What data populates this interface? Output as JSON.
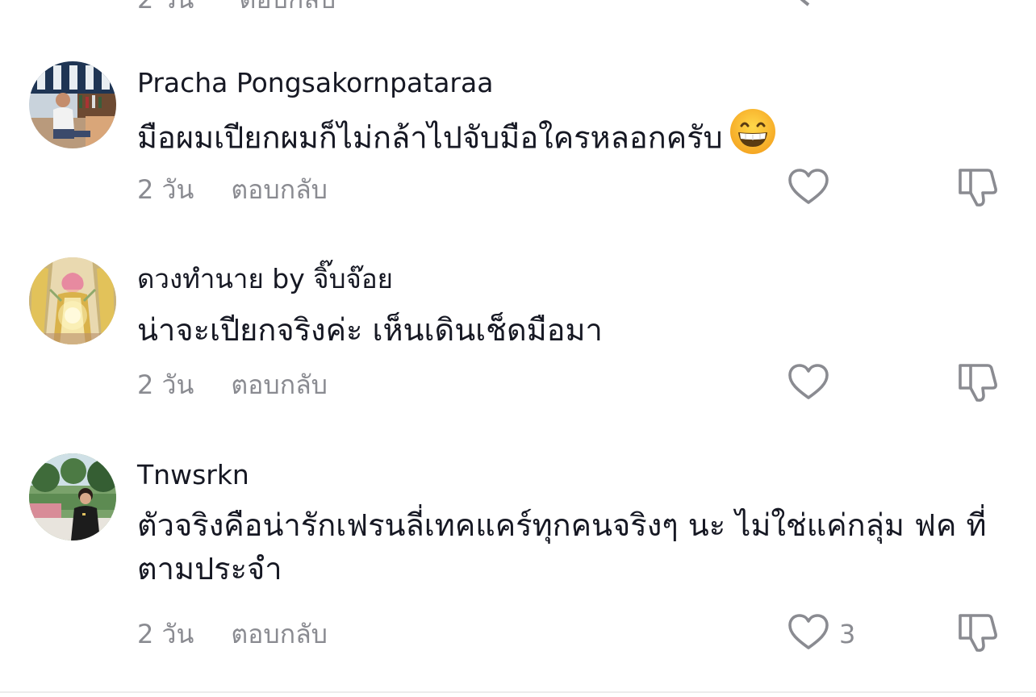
{
  "previous_comment": {
    "time": "2 วัน",
    "reply_label": "ตอบกลับ"
  },
  "comments": [
    {
      "username": "Pracha Pongsakornpataraa",
      "text": "มือผมเปียกผมก็ไม่กล้าไปจับมือใครหลอกครับ",
      "emoji": "grinning-face-emoji",
      "time": "2 วัน",
      "reply_label": "ตอบกลับ",
      "like_count": ""
    },
    {
      "username": "ดวงทำนาย by จิ๊บจ๊อย",
      "text": "น่าจะเปียกจริงค่ะ เห็นเดินเช็ดมือมา",
      "time": "2 วัน",
      "reply_label": "ตอบกลับ",
      "like_count": ""
    },
    {
      "username": "Tnwsrkn",
      "text": "ตัวจริงคือน่ารักเฟรนลี่เทคแคร์ทุกคนจริงๆ นะ ไม่ใช่แค่กลุ่ม ฟค ที่ตามประจำ",
      "time": "2 วัน",
      "reply_label": "ตอบกลับ",
      "like_count": "3"
    }
  ],
  "icons": {
    "like": "heart-outline-icon",
    "dislike": "thumbs-down-outline-icon"
  },
  "colors": {
    "text_primary": "#161823",
    "text_secondary": "#8a8b91",
    "icon": "#8a8b91"
  }
}
